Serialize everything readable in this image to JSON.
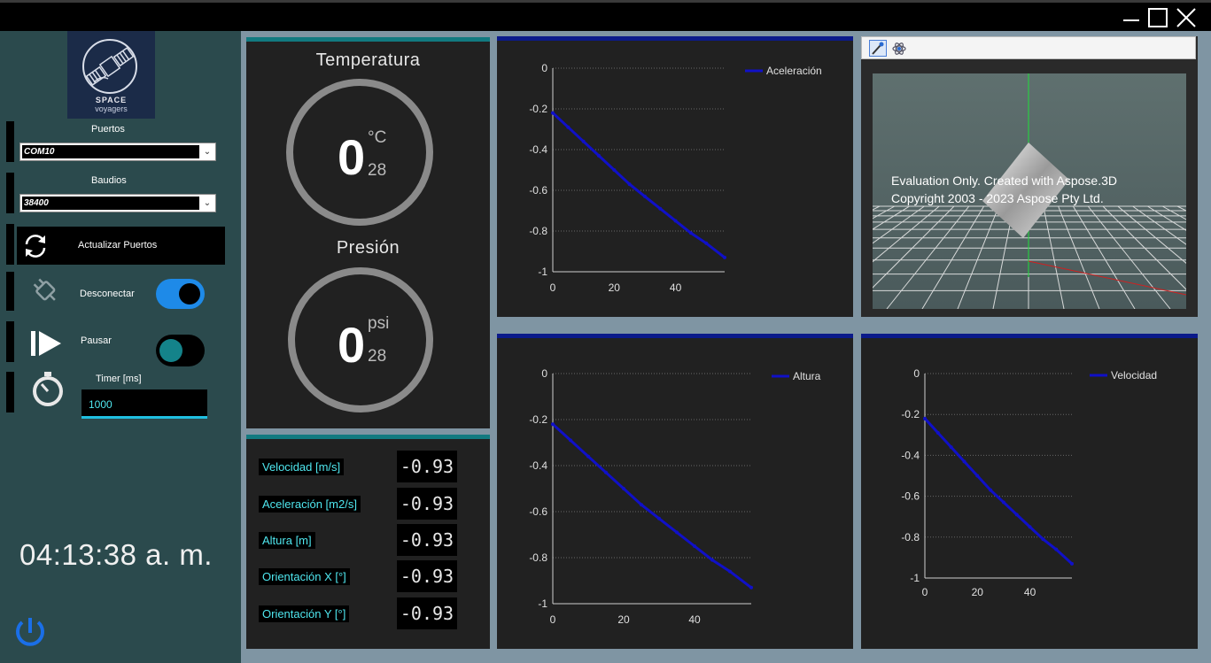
{
  "sidebar": {
    "logo_line1": "SPACE",
    "logo_line2": "voyagers",
    "puertos_label": "Puertos",
    "puertos_value": "COM10",
    "baudios_label": "Baudios",
    "baudios_value": "38400",
    "refresh_label": "Actualizar Puertos",
    "disconnect_label": "Desconectar",
    "disconnect_on": true,
    "pause_label": "Pausar",
    "pause_on": false,
    "timer_label": "Timer [ms]",
    "timer_value": "1000",
    "clock": "04:13:38 a. m."
  },
  "gauges": {
    "temperature": {
      "title": "Temperatura",
      "value": "0",
      "unit": "°C",
      "sub": "28"
    },
    "pressure": {
      "title": "Presión",
      "value": "0",
      "unit": "psi",
      "sub": "28"
    }
  },
  "readouts": [
    {
      "label": "Velocidad [m/s]",
      "value": "-0.93"
    },
    {
      "label": "Aceleración  [m2/s]",
      "value": "-0.93"
    },
    {
      "label": "Altura [m]",
      "value": "-0.93"
    },
    {
      "label": "Orientación X  [°]",
      "value": "-0.93"
    },
    {
      "label": "Orientación Y  [°]",
      "value": "-0.93"
    }
  ],
  "viewer": {
    "watermark_line1": "Evaluation Only. Created with Aspose.3D",
    "watermark_line2": "Copyright 2003 - 2023 Aspose Pty Ltd."
  },
  "chart_data": [
    {
      "type": "line",
      "series": [
        {
          "name": "Aceleración",
          "x": [
            0,
            5,
            10,
            15,
            20,
            25,
            30,
            35,
            40,
            45,
            50,
            56
          ],
          "y": [
            -0.22,
            -0.29,
            -0.36,
            -0.43,
            -0.5,
            -0.57,
            -0.63,
            -0.69,
            -0.75,
            -0.81,
            -0.86,
            -0.93
          ]
        }
      ],
      "xlim": [
        0,
        56
      ],
      "ylim": [
        -1,
        0
      ],
      "xticks": [
        "0",
        "20",
        "40"
      ],
      "yticks": [
        "0",
        "-0.2",
        "-0.4",
        "-0.6",
        "-0.8",
        "-1"
      ],
      "grid": true,
      "legend": "top-right",
      "color": "#1010c8"
    },
    {
      "type": "line",
      "series": [
        {
          "name": "Altura",
          "x": [
            0,
            5,
            10,
            15,
            20,
            25,
            30,
            35,
            40,
            45,
            50,
            56
          ],
          "y": [
            -0.22,
            -0.29,
            -0.36,
            -0.43,
            -0.5,
            -0.57,
            -0.63,
            -0.69,
            -0.75,
            -0.81,
            -0.86,
            -0.93
          ]
        }
      ],
      "xlim": [
        0,
        56
      ],
      "ylim": [
        -1,
        0
      ],
      "xticks": [
        "0",
        "20",
        "40"
      ],
      "yticks": [
        "0",
        "-0.2",
        "-0.4",
        "-0.6",
        "-0.8",
        "-1"
      ],
      "grid": true,
      "legend": "top-right",
      "color": "#1010c8"
    },
    {
      "type": "line",
      "series": [
        {
          "name": "Velocidad",
          "x": [
            0,
            5,
            10,
            15,
            20,
            25,
            30,
            35,
            40,
            45,
            50,
            56
          ],
          "y": [
            -0.22,
            -0.29,
            -0.36,
            -0.43,
            -0.5,
            -0.57,
            -0.63,
            -0.69,
            -0.75,
            -0.81,
            -0.86,
            -0.93
          ]
        }
      ],
      "xlim": [
        0,
        56
      ],
      "ylim": [
        -1,
        0
      ],
      "xticks": [
        "0",
        "20",
        "40"
      ],
      "yticks": [
        "0",
        "-0.2",
        "-0.4",
        "-0.6",
        "-0.8",
        "-1"
      ],
      "grid": true,
      "legend": "top-right",
      "color": "#1010c8"
    }
  ]
}
